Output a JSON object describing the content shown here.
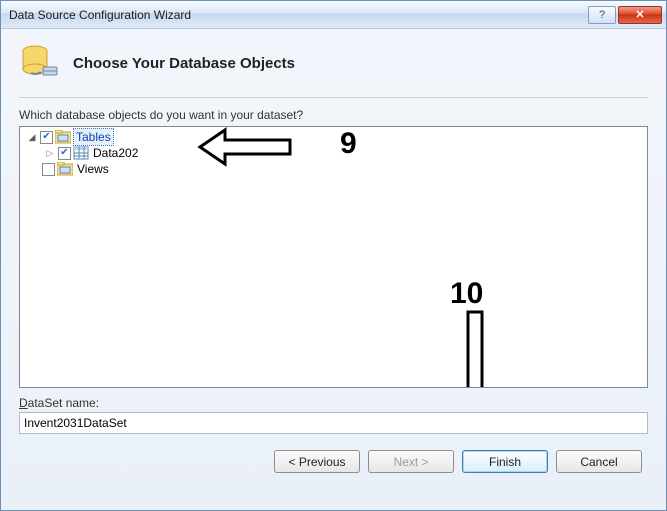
{
  "titlebar": {
    "title": "Data Source Configuration Wizard"
  },
  "header": {
    "title": "Choose Your Database Objects"
  },
  "prompt": "Which database objects do you want in your dataset?",
  "tree": {
    "tables_label": "Tables",
    "data202_label": "Data202",
    "views_label": "Views"
  },
  "dataset": {
    "label_pre": "D",
    "label_rest": "ataSet name:",
    "value": "Invent2031DataSet"
  },
  "buttons": {
    "previous": "< Previous",
    "next": "Next >",
    "finish": "Finish",
    "cancel": "Cancel"
  },
  "annotations": {
    "nine": "9",
    "ten": "10"
  }
}
